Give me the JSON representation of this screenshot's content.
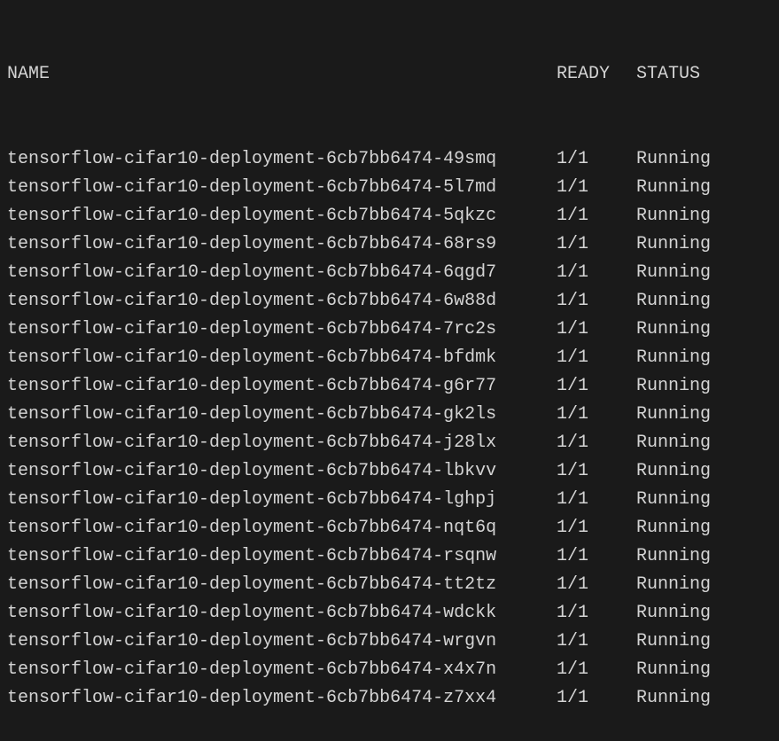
{
  "table": {
    "headers": {
      "name": "NAME",
      "ready": "READY",
      "status": "STATUS"
    },
    "pods": [
      {
        "name": "tensorflow-cifar10-deployment-6cb7bb6474-49smq",
        "ready": "1/1",
        "status": "Running"
      },
      {
        "name": "tensorflow-cifar10-deployment-6cb7bb6474-5l7md",
        "ready": "1/1",
        "status": "Running"
      },
      {
        "name": "tensorflow-cifar10-deployment-6cb7bb6474-5qkzc",
        "ready": "1/1",
        "status": "Running"
      },
      {
        "name": "tensorflow-cifar10-deployment-6cb7bb6474-68rs9",
        "ready": "1/1",
        "status": "Running"
      },
      {
        "name": "tensorflow-cifar10-deployment-6cb7bb6474-6qgd7",
        "ready": "1/1",
        "status": "Running"
      },
      {
        "name": "tensorflow-cifar10-deployment-6cb7bb6474-6w88d",
        "ready": "1/1",
        "status": "Running"
      },
      {
        "name": "tensorflow-cifar10-deployment-6cb7bb6474-7rc2s",
        "ready": "1/1",
        "status": "Running"
      },
      {
        "name": "tensorflow-cifar10-deployment-6cb7bb6474-bfdmk",
        "ready": "1/1",
        "status": "Running"
      },
      {
        "name": "tensorflow-cifar10-deployment-6cb7bb6474-g6r77",
        "ready": "1/1",
        "status": "Running"
      },
      {
        "name": "tensorflow-cifar10-deployment-6cb7bb6474-gk2ls",
        "ready": "1/1",
        "status": "Running"
      },
      {
        "name": "tensorflow-cifar10-deployment-6cb7bb6474-j28lx",
        "ready": "1/1",
        "status": "Running"
      },
      {
        "name": "tensorflow-cifar10-deployment-6cb7bb6474-lbkvv",
        "ready": "1/1",
        "status": "Running"
      },
      {
        "name": "tensorflow-cifar10-deployment-6cb7bb6474-lghpj",
        "ready": "1/1",
        "status": "Running"
      },
      {
        "name": "tensorflow-cifar10-deployment-6cb7bb6474-nqt6q",
        "ready": "1/1",
        "status": "Running"
      },
      {
        "name": "tensorflow-cifar10-deployment-6cb7bb6474-rsqnw",
        "ready": "1/1",
        "status": "Running"
      },
      {
        "name": "tensorflow-cifar10-deployment-6cb7bb6474-tt2tz",
        "ready": "1/1",
        "status": "Running"
      },
      {
        "name": "tensorflow-cifar10-deployment-6cb7bb6474-wdckk",
        "ready": "1/1",
        "status": "Running"
      },
      {
        "name": "tensorflow-cifar10-deployment-6cb7bb6474-wrgvn",
        "ready": "1/1",
        "status": "Running"
      },
      {
        "name": "tensorflow-cifar10-deployment-6cb7bb6474-x4x7n",
        "ready": "1/1",
        "status": "Running"
      },
      {
        "name": "tensorflow-cifar10-deployment-6cb7bb6474-z7xx4",
        "ready": "1/1",
        "status": "Running"
      }
    ]
  }
}
